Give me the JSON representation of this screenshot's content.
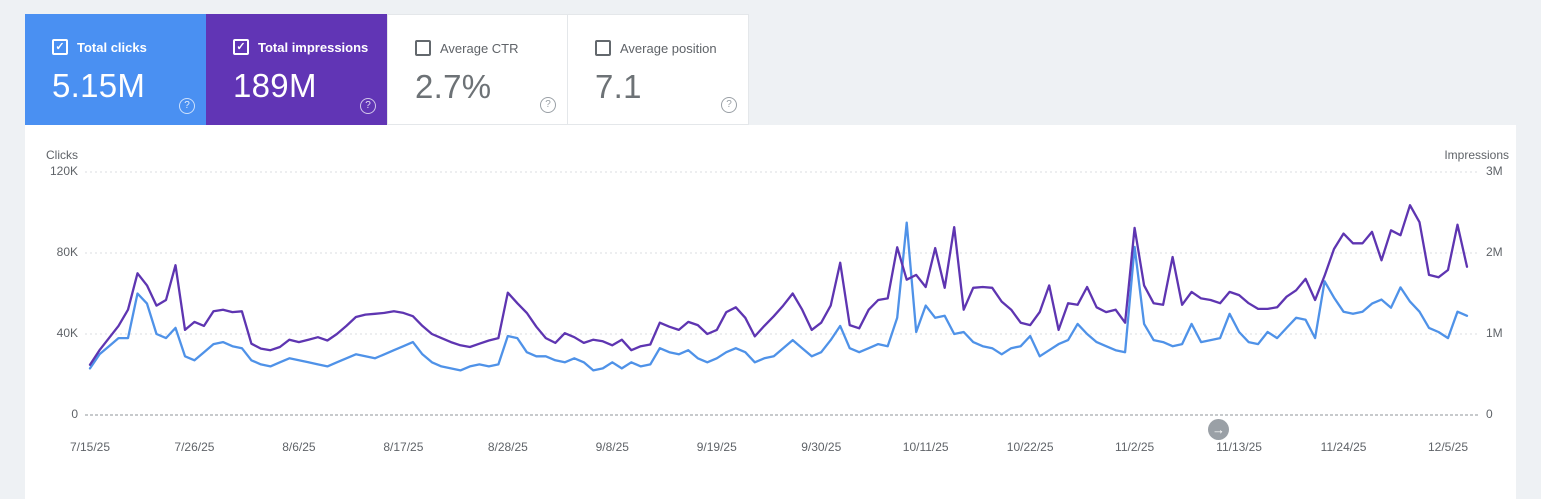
{
  "icons": {
    "help_glyph": "?",
    "check_glyph": "✓",
    "next_arrow_glyph": "→"
  },
  "cards": [
    {
      "label": "Total clicks",
      "value": "5.15M",
      "checked": true,
      "color": "#4a90f2"
    },
    {
      "label": "Total impressions",
      "value": "189M",
      "checked": true,
      "color": "#6135b5"
    },
    {
      "label": "Average CTR",
      "value": "2.7%",
      "checked": false,
      "color": "#ffffff"
    },
    {
      "label": "Average position",
      "value": "7.1",
      "checked": false,
      "color": "#ffffff"
    }
  ],
  "chart_data": {
    "type": "line",
    "frequency": "daily",
    "start_date": "7/15/25",
    "end_date": "12/7/25",
    "x_tick_labels": [
      "7/15/25",
      "7/26/25",
      "8/6/25",
      "8/17/25",
      "8/28/25",
      "9/8/25",
      "9/19/25",
      "9/30/25",
      "10/11/25",
      "10/22/25",
      "11/2/25",
      "11/13/25",
      "11/24/25",
      "12/5/25"
    ],
    "left_axis": {
      "label": "Clicks",
      "ticks": [
        "0",
        "40K",
        "80K",
        "120K"
      ],
      "max": 120,
      "unit": "thousands"
    },
    "right_axis": {
      "label": "Impressions",
      "ticks": [
        "0",
        "1M",
        "2M",
        "3M"
      ],
      "max": 3,
      "unit": "millions"
    },
    "grid": "horizontal-dashed",
    "legend": "none",
    "series": [
      {
        "name": "Clicks",
        "color": "#4f92e8",
        "axis": "left",
        "unit": "thousands",
        "values": [
          23,
          30,
          34,
          38,
          38,
          60,
          55,
          40,
          38,
          43,
          29,
          27,
          31,
          35,
          36,
          34,
          33,
          27,
          25,
          24,
          26,
          28,
          27,
          26,
          25,
          24,
          26,
          28,
          30,
          29,
          28,
          30,
          32,
          34,
          36,
          30,
          26,
          24,
          23,
          22,
          24,
          25,
          24,
          25,
          39,
          38,
          31,
          29,
          29,
          27,
          26,
          28,
          26,
          22,
          23,
          26,
          23,
          26,
          24,
          25,
          33,
          31,
          30,
          32,
          28,
          26,
          28,
          31,
          33,
          31,
          26,
          28,
          29,
          33,
          37,
          33,
          29,
          31,
          37,
          44,
          33,
          31,
          33,
          35,
          34,
          48,
          95,
          41,
          54,
          48,
          49,
          40,
          41,
          36,
          34,
          33,
          30,
          33,
          34,
          39,
          29,
          32,
          35,
          37,
          45,
          40,
          36,
          34,
          32,
          31,
          83,
          45,
          37,
          36,
          34,
          35,
          45,
          36,
          37,
          38,
          50,
          41,
          36,
          35,
          41,
          38,
          43,
          48,
          47,
          38,
          66,
          58,
          51,
          50,
          51,
          55,
          57,
          53,
          63,
          56,
          51,
          43,
          41,
          38,
          51,
          49
        ]
      },
      {
        "name": "Impressions",
        "color": "#5e35b1",
        "axis": "right",
        "unit": "millions",
        "values": [
          0.62,
          0.8,
          0.95,
          1.1,
          1.3,
          1.75,
          1.6,
          1.35,
          1.42,
          1.85,
          1.05,
          1.15,
          1.1,
          1.28,
          1.3,
          1.27,
          1.28,
          0.88,
          0.82,
          0.8,
          0.84,
          0.93,
          0.9,
          0.93,
          0.96,
          0.92,
          1.0,
          1.1,
          1.21,
          1.24,
          1.25,
          1.26,
          1.28,
          1.26,
          1.22,
          1.1,
          1.0,
          0.95,
          0.9,
          0.86,
          0.84,
          0.88,
          0.92,
          0.95,
          1.51,
          1.38,
          1.26,
          1.09,
          0.95,
          0.89,
          1.01,
          0.96,
          0.89,
          0.93,
          0.91,
          0.86,
          0.93,
          0.8,
          0.85,
          0.87,
          1.14,
          1.09,
          1.05,
          1.15,
          1.11,
          1.0,
          1.05,
          1.27,
          1.33,
          1.2,
          0.97,
          1.1,
          1.22,
          1.35,
          1.5,
          1.3,
          1.05,
          1.14,
          1.35,
          1.88,
          1.11,
          1.07,
          1.3,
          1.42,
          1.44,
          2.07,
          1.67,
          1.73,
          1.58,
          2.06,
          1.57,
          2.32,
          1.3,
          1.57,
          1.58,
          1.57,
          1.4,
          1.3,
          1.14,
          1.11,
          1.27,
          1.6,
          1.05,
          1.38,
          1.36,
          1.58,
          1.33,
          1.27,
          1.3,
          1.14,
          2.31,
          1.6,
          1.38,
          1.36,
          1.95,
          1.36,
          1.52,
          1.44,
          1.42,
          1.38,
          1.52,
          1.48,
          1.38,
          1.31,
          1.31,
          1.33,
          1.46,
          1.54,
          1.68,
          1.42,
          1.72,
          2.05,
          2.24,
          2.12,
          2.12,
          2.26,
          1.91,
          2.28,
          2.22,
          2.59,
          2.38,
          1.73,
          1.7,
          1.79,
          2.35,
          1.83
        ]
      }
    ]
  }
}
